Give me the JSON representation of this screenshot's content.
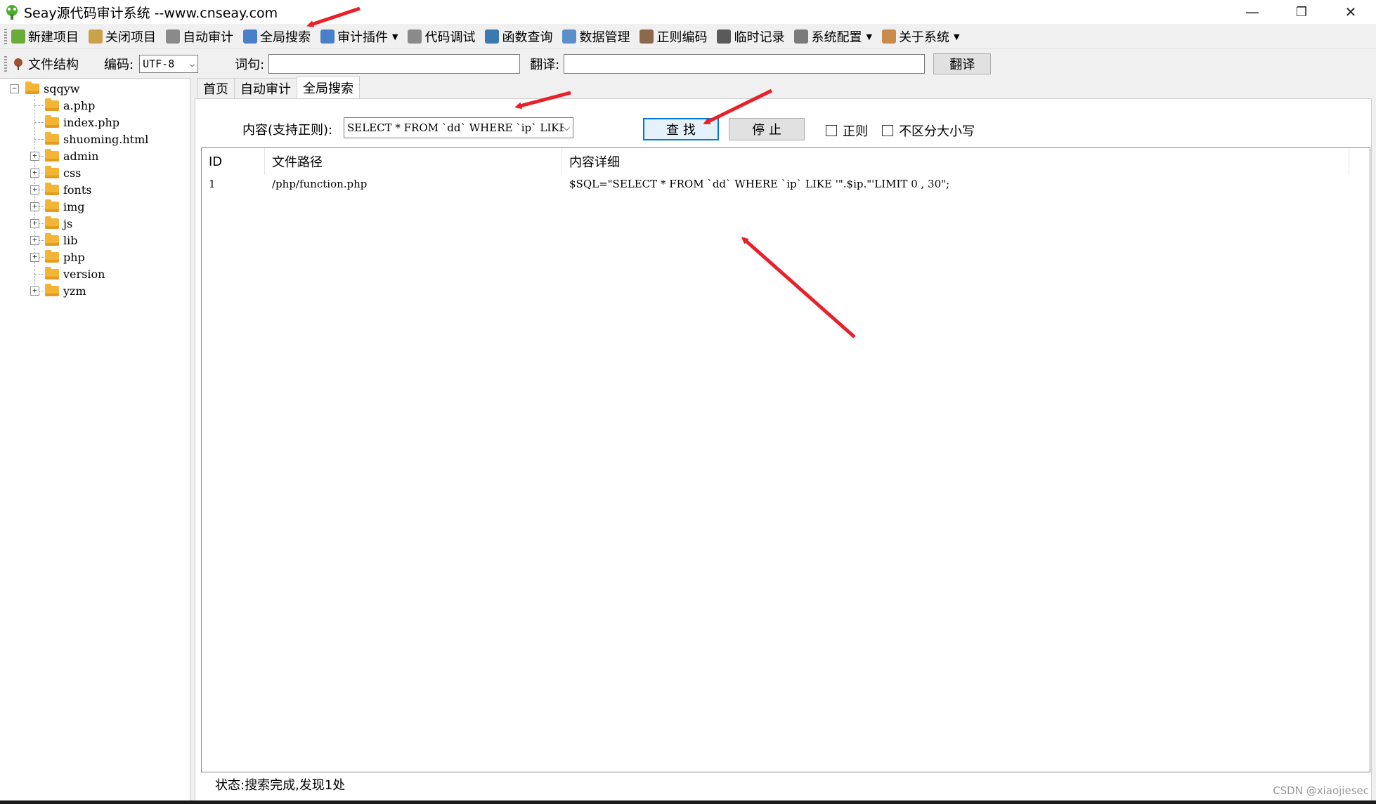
{
  "window": {
    "title": "Seay源代码审计系统 --www.cnseay.com",
    "minimize": "—",
    "restore": "❐",
    "close": "✕"
  },
  "toolbar": {
    "items": [
      {
        "label": "新建项目",
        "icon": "new-project-icon"
      },
      {
        "label": "关闭项目",
        "icon": "close-project-icon"
      },
      {
        "label": "自动审计",
        "icon": "auto-audit-icon"
      },
      {
        "label": "全局搜索",
        "icon": "global-search-icon"
      },
      {
        "label": "审计插件",
        "icon": "plugin-icon",
        "dropdown": true
      },
      {
        "label": "代码调试",
        "icon": "debug-icon"
      },
      {
        "label": "函数查询",
        "icon": "function-search-icon"
      },
      {
        "label": "数据管理",
        "icon": "data-manage-icon"
      },
      {
        "label": "正则编码",
        "icon": "regex-encode-icon"
      },
      {
        "label": "临时记录",
        "icon": "temp-record-icon"
      },
      {
        "label": "系统配置",
        "icon": "gear-icon",
        "dropdown": true
      },
      {
        "label": "关于系统",
        "icon": "about-icon",
        "dropdown": true
      }
    ]
  },
  "toolbar2": {
    "file_structure": "文件结构",
    "encoding_label": "编码:",
    "encoding_value": "UTF-8",
    "word_label": "词句:",
    "word_value": "",
    "translate_label": "翻译:",
    "translate_value": "",
    "translate_button": "翻译"
  },
  "tree": {
    "root": "sqqyw",
    "items": [
      {
        "label": "a.php",
        "expandable": false
      },
      {
        "label": "index.php",
        "expandable": false
      },
      {
        "label": "shuoming.html",
        "expandable": false
      },
      {
        "label": "admin",
        "expandable": true
      },
      {
        "label": "css",
        "expandable": true
      },
      {
        "label": "fonts",
        "expandable": true
      },
      {
        "label": "img",
        "expandable": true
      },
      {
        "label": "js",
        "expandable": true
      },
      {
        "label": "lib",
        "expandable": true
      },
      {
        "label": "php",
        "expandable": true
      },
      {
        "label": "version",
        "expandable": false
      },
      {
        "label": "yzm",
        "expandable": true
      }
    ]
  },
  "tabs": [
    {
      "label": "首页",
      "active": false
    },
    {
      "label": "自动审计",
      "active": false
    },
    {
      "label": "全局搜索",
      "active": true
    }
  ],
  "search": {
    "label": "内容(支持正则):",
    "query": "SELECT * FROM `dd` WHERE `ip` LIKE",
    "find_button": "查 找",
    "stop_button": "停 止",
    "regex_checkbox": "正则",
    "regex_checked": false,
    "case_checkbox": "不区分大小写",
    "case_checked": false
  },
  "results": {
    "columns": [
      "ID",
      "文件路径",
      "内容详细"
    ],
    "rows": [
      {
        "id": "1",
        "path": "/php/function.php",
        "detail": "$SQL=\"SELECT * FROM `dd` WHERE `ip` LIKE '\".$ip.\"'LIMIT 0 , 30\";"
      }
    ]
  },
  "status": "状态:搜索完成,发现1处",
  "watermark": "CSDN @xiaojiesec",
  "colors": {
    "annotation_arrow": "#e8202a",
    "folder": "#f4b436",
    "find_button_border": "#0078d7"
  }
}
